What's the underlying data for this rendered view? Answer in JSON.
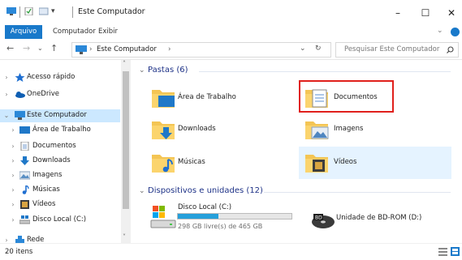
{
  "window": {
    "title": "Este Computador",
    "controls": {
      "minimize": "–",
      "maximize": "☐",
      "close": "✕"
    }
  },
  "ribbon": {
    "tabs": [
      "Arquivo",
      "Computador",
      "Exibir"
    ],
    "collapse_icon": "chevron-down-icon",
    "help_icon": "help-icon"
  },
  "address_bar": {
    "path": "Este Computador",
    "separator": "›",
    "search_placeholder": "Pesquisar Este Computador"
  },
  "nav_pane": {
    "items": [
      {
        "label": "Acesso rápido",
        "icon": "star-icon",
        "selected": false
      },
      {
        "label": "OneDrive",
        "icon": "cloud-icon",
        "selected": false
      },
      {
        "label": "Este Computador",
        "icon": "computer-icon",
        "selected": true,
        "expanded": true
      },
      {
        "label": "Área de Trabalho",
        "icon": "desktop-icon",
        "child": true
      },
      {
        "label": "Documentos",
        "icon": "document-icon",
        "child": true
      },
      {
        "label": "Downloads",
        "icon": "download-icon",
        "child": true
      },
      {
        "label": "Imagens",
        "icon": "pictures-icon",
        "child": true
      },
      {
        "label": "Músicas",
        "icon": "music-icon",
        "child": true
      },
      {
        "label": "Vídeos",
        "icon": "video-icon",
        "child": true
      },
      {
        "label": "Disco Local (C:)",
        "icon": "drive-icon",
        "child": true
      },
      {
        "label": "Rede",
        "icon": "network-icon",
        "selected": false
      }
    ]
  },
  "content": {
    "folders_header": "Pastas (6)",
    "folders": [
      {
        "label": "Área de Trabalho",
        "icon": "desktop-folder-icon"
      },
      {
        "label": "Documentos",
        "icon": "documents-folder-icon",
        "highlighted": true
      },
      {
        "label": "Downloads",
        "icon": "downloads-folder-icon"
      },
      {
        "label": "Imagens",
        "icon": "pictures-folder-icon"
      },
      {
        "label": "Músicas",
        "icon": "music-folder-icon"
      },
      {
        "label": "Vídeos",
        "icon": "videos-folder-icon",
        "hovered": true
      }
    ],
    "devices_header": "Dispositivos e unidades (12)",
    "devices": [
      {
        "label": "Disco Local (C:)",
        "icon": "hard-drive-icon",
        "free_text": "298 GB livre(s) de 465 GB",
        "used_fraction": 0.36
      },
      {
        "label": "Unidade de BD-ROM (D:)",
        "icon": "bd-rom-icon"
      }
    ]
  },
  "status_bar": {
    "item_count": "20 itens"
  },
  "colors": {
    "accent": "#1979ca",
    "selection": "#cce8ff",
    "hover": "#e5f3ff",
    "highlight_border": "#e0201c",
    "group_header": "#1e3287",
    "drive_fill": "#26a0da"
  }
}
